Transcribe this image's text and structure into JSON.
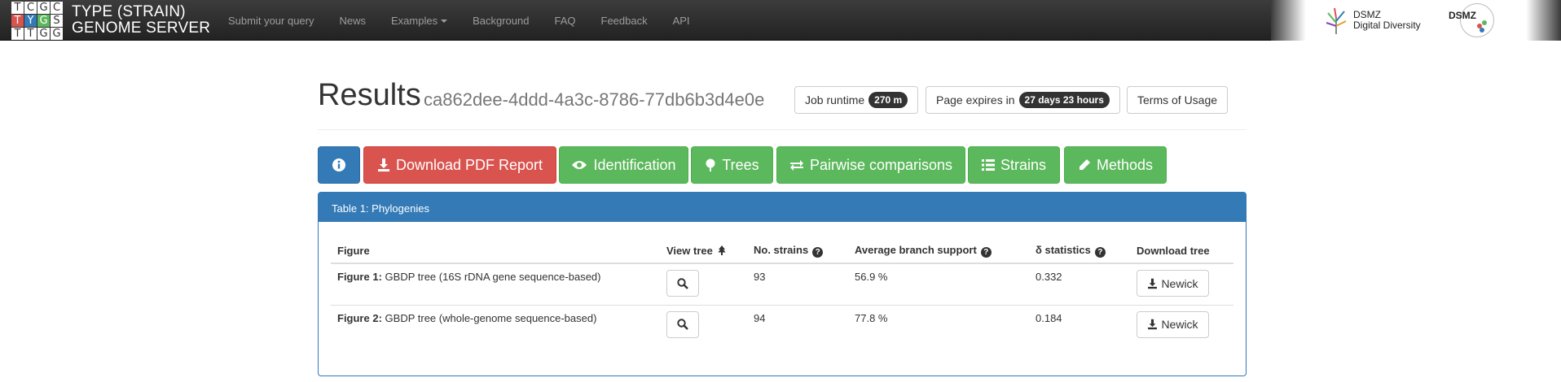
{
  "navbar": {
    "logo_letters": [
      [
        "T",
        "C",
        "G",
        "C"
      ],
      [
        "T",
        "Y",
        "G",
        "S"
      ],
      [
        "T",
        "T",
        "G",
        "G"
      ]
    ],
    "brand_line1": "TYPE (STRAIN)",
    "brand_line2": "GENOME SERVER",
    "links": [
      "Submit your query",
      "News",
      "Examples",
      "Background",
      "FAQ",
      "Feedback",
      "API"
    ],
    "dsmz_line1": "DSMZ",
    "dsmz_line2": "Digital Diversity",
    "dsmz_logo": "DSMZ"
  },
  "header": {
    "title": "Results",
    "job_id": "ca862dee-4ddd-4a3c-8786-77db6b3d4e0e",
    "runtime_label": "Job runtime",
    "runtime_value": "270 m",
    "expires_label": "Page expires in",
    "expires_value": "27 days 23 hours",
    "terms_label": "Terms of Usage"
  },
  "tabs": {
    "info_icon": "info-circle-icon",
    "download_pdf": "Download PDF Report",
    "identification": "Identification",
    "trees": "Trees",
    "pairwise": "Pairwise comparisons",
    "strains": "Strains",
    "methods": "Methods"
  },
  "panel": {
    "title": "Table 1: Phylogenies",
    "columns": [
      "Figure",
      "View tree",
      "No. strains",
      "Average branch support",
      "δ statistics",
      "Download tree"
    ],
    "rows": [
      {
        "figure_label": "Figure 1:",
        "figure_desc": "GBDP tree (16S rDNA gene sequence-based)",
        "strains": "93",
        "support": "56.9 %",
        "delta": "0.332",
        "download": "Newick"
      },
      {
        "figure_label": "Figure 2:",
        "figure_desc": "GBDP tree (whole-genome sequence-based)",
        "strains": "94",
        "support": "77.8 %",
        "delta": "0.184",
        "download": "Newick"
      }
    ]
  },
  "colors": {
    "primary": "#337ab7",
    "danger": "#d9534f",
    "success": "#5cb85c",
    "navbar": "#222222"
  }
}
